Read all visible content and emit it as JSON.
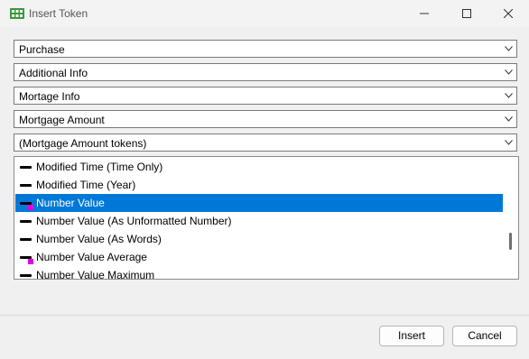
{
  "window": {
    "title": "Insert Token",
    "app_icon": "grid-app-icon",
    "controls": [
      "minimize-icon",
      "maximize-icon",
      "close-icon"
    ]
  },
  "dropdowns": [
    {
      "value": "Purchase"
    },
    {
      "value": "Additional Info"
    },
    {
      "value": "Mortage Info"
    },
    {
      "value": "Mortgage Amount"
    },
    {
      "value": "(Mortgage Amount tokens)"
    }
  ],
  "token_list": {
    "items": [
      {
        "label": "Modified Time (Time Only)",
        "icon": "token-icon",
        "marker": false,
        "selected": false
      },
      {
        "label": "Modified Time (Year)",
        "icon": "token-icon",
        "marker": false,
        "selected": false
      },
      {
        "label": "Number Value",
        "icon": "token-icon",
        "marker": true,
        "selected": true
      },
      {
        "label": "Number Value (As Unformatted Number)",
        "icon": "token-icon",
        "marker": false,
        "selected": false
      },
      {
        "label": "Number Value (As Words)",
        "icon": "token-icon",
        "marker": false,
        "selected": false
      },
      {
        "label": "Number Value Average",
        "icon": "token-icon",
        "marker": true,
        "selected": false
      },
      {
        "label": "Number Value Maximum",
        "icon": "token-icon",
        "marker": false,
        "selected": false
      }
    ]
  },
  "buttons": {
    "insert": "Insert",
    "cancel": "Cancel"
  },
  "colors": {
    "selection": "#0078d7",
    "marker": "#e000e0",
    "background": "#f0f0f0"
  }
}
